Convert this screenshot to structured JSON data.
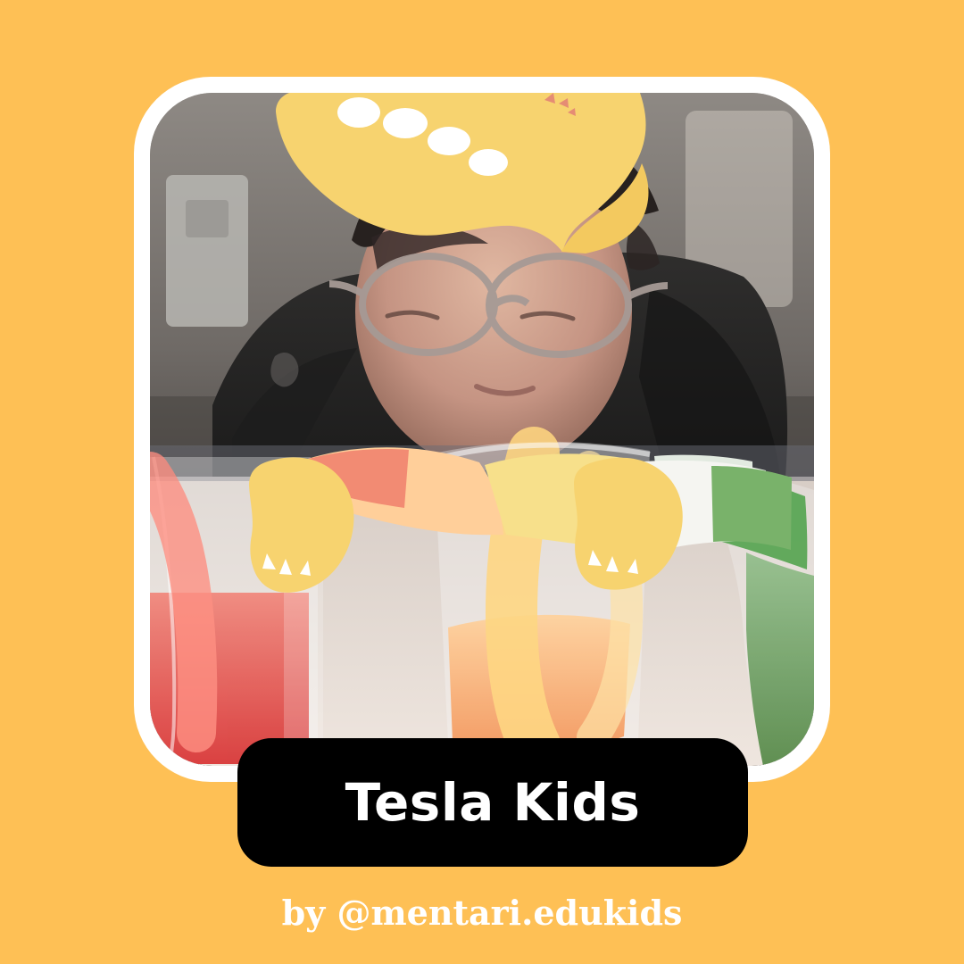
{
  "title": "Tesla Kids",
  "credit": "by @mentari.edukids",
  "colors": {
    "background": "#FEC055",
    "frame": "#FFFFFF",
    "title_pill": "#000000",
    "text": "#FFFFFF",
    "sticker": "#F7D36F"
  },
  "icons": {
    "sticker": "chick-sticker-icon",
    "paws": "paw-icon"
  }
}
